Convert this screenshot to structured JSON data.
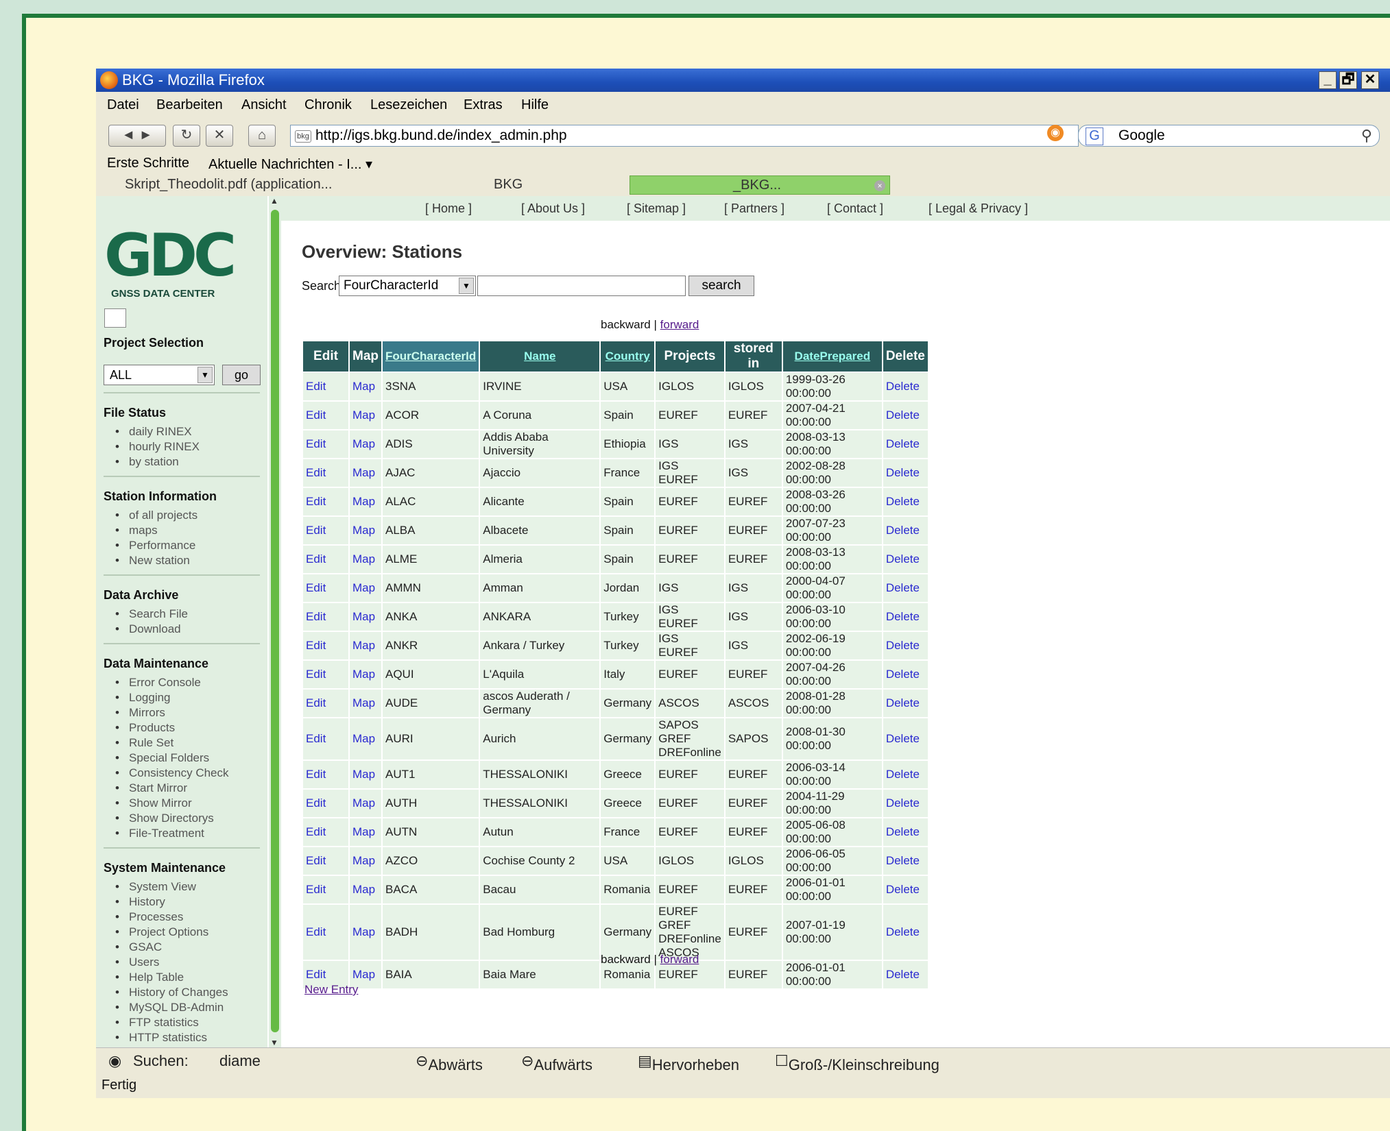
{
  "window": {
    "title": "BKG - Mozilla Firefox",
    "min": "_",
    "max": "🗗",
    "close": "✕"
  },
  "menu": [
    "Datei",
    "Bearbeiten",
    "Ansicht",
    "Chronik",
    "Lesezeichen",
    "Extras",
    "Hilfe"
  ],
  "nav": {
    "url": "http://igs.bkg.bund.de/index_admin.php",
    "search_engine": "Google"
  },
  "bookmarks": [
    "Erste Schritte",
    "Aktuelle Nachrichten - I... ▾"
  ],
  "tabs": [
    {
      "label": "Skript_Theodolit.pdf (application..."
    },
    {
      "label": "BKG"
    },
    {
      "label": "_BKG..."
    }
  ],
  "topnav": [
    "[ Home ]",
    "[ About Us ]",
    "[ Sitemap ]",
    "[ Partners ]",
    "[ Contact ]",
    "[ Legal & Privacy ]"
  ],
  "sidebar": {
    "logo_big": "GDC",
    "logo_small": "GNSS DATA CENTER",
    "project_selection": "Project Selection",
    "project_value": "ALL",
    "go_label": "go",
    "file_status": {
      "title": "File Status",
      "items": [
        "daily RINEX",
        "hourly RINEX",
        "by station"
      ]
    },
    "station_info": {
      "title": "Station Information",
      "items": [
        "of all projects",
        "maps",
        "Performance",
        "New station"
      ]
    },
    "data_archive": {
      "title": "Data Archive",
      "items": [
        "Search File",
        "Download"
      ]
    },
    "data_maintenance": {
      "title": "Data Maintenance",
      "items": [
        "Error Console",
        "Logging",
        "Mirrors",
        "Products",
        "Rule Set",
        "Special Folders",
        "Consistency Check",
        "Start Mirror",
        "Show Mirror",
        "Show Directorys",
        "File-Treatment"
      ]
    },
    "system_maintenance": {
      "title": "System Maintenance",
      "items": [
        "System View",
        "History",
        "Processes",
        "Project Options",
        "GSAC",
        "Users",
        "Help Table",
        "History of Changes",
        "MySQL DB-Admin",
        "FTP statistics",
        "HTTP statistics"
      ]
    }
  },
  "main": {
    "title": "Overview: Stations",
    "search_label": "Search:",
    "search_field": "FourCharacterId",
    "search_button": "search",
    "pager_backward": "backward",
    "pager_sep": " | ",
    "pager_forward": "forward",
    "headers": [
      "Edit",
      "Map",
      "FourCharacterId",
      "Name",
      "Country",
      "Projects",
      "stored in",
      "DatePrepared",
      "Delete"
    ],
    "edit_label": "Edit",
    "map_label": "Map",
    "delete_label": "Delete",
    "rows": [
      [
        "3SNA",
        "IRVINE",
        "USA",
        "IGLOS",
        "IGLOS",
        "1999-03-26 00:00:00"
      ],
      [
        "ACOR",
        "A Coruna",
        "Spain",
        "EUREF",
        "EUREF",
        "2007-04-21 00:00:00"
      ],
      [
        "ADIS",
        "Addis Ababa University",
        "Ethiopia",
        "IGS",
        "IGS",
        "2008-03-13 00:00:00"
      ],
      [
        "AJAC",
        "Ajaccio",
        "France",
        "IGS\nEUREF",
        "IGS",
        "2002-08-28 00:00:00"
      ],
      [
        "ALAC",
        "Alicante",
        "Spain",
        "EUREF",
        "EUREF",
        "2008-03-26 00:00:00"
      ],
      [
        "ALBA",
        "Albacete",
        "Spain",
        "EUREF",
        "EUREF",
        "2007-07-23 00:00:00"
      ],
      [
        "ALME",
        "Almeria",
        "Spain",
        "EUREF",
        "EUREF",
        "2008-03-13 00:00:00"
      ],
      [
        "AMMN",
        "Amman",
        "Jordan",
        "IGS",
        "IGS",
        "2000-04-07 00:00:00"
      ],
      [
        "ANKA",
        "ANKARA",
        "Turkey",
        "IGS\nEUREF",
        "IGS",
        "2006-03-10 00:00:00"
      ],
      [
        "ANKR",
        "Ankara / Turkey",
        "Turkey",
        "IGS\nEUREF",
        "IGS",
        "2002-06-19 00:00:00"
      ],
      [
        "AQUI",
        "L'Aquila",
        "Italy",
        "EUREF",
        "EUREF",
        "2007-04-26 00:00:00"
      ],
      [
        "AUDE",
        "ascos Auderath / Germany",
        "Germany",
        "ASCOS",
        "ASCOS",
        "2008-01-28 00:00:00"
      ],
      [
        "AURI",
        "Aurich",
        "Germany",
        "SAPOS\nGREF\nDREFonline",
        "SAPOS",
        "2008-01-30 00:00:00"
      ],
      [
        "AUT1",
        "THESSALONIKI",
        "Greece",
        "EUREF",
        "EUREF",
        "2006-03-14 00:00:00"
      ],
      [
        "AUTH",
        "THESSALONIKI",
        "Greece",
        "EUREF",
        "EUREF",
        "2004-11-29 00:00:00"
      ],
      [
        "AUTN",
        "Autun",
        "France",
        "EUREF",
        "EUREF",
        "2005-06-08 00:00:00"
      ],
      [
        "AZCO",
        "Cochise County 2",
        "USA",
        "IGLOS",
        "IGLOS",
        "2006-06-05 00:00:00"
      ],
      [
        "BACA",
        "Bacau",
        "Romania",
        "EUREF",
        "EUREF",
        "2006-01-01 00:00:00"
      ],
      [
        "BADH",
        "Bad Homburg",
        "Germany",
        "EUREF\nGREF\nDREFonline\nASCOS",
        "EUREF",
        "2007-01-19 00:00:00"
      ],
      [
        "BAIA",
        "Baia Mare",
        "Romania",
        "EUREF",
        "EUREF",
        "2006-01-01 00:00:00"
      ]
    ],
    "new_entry": "New Entry"
  },
  "findbar": {
    "label": "Suchen:",
    "value": "diame",
    "down": "Abwärts",
    "up": "Aufwärts",
    "highlight": "Hervorheben",
    "case": "Groß-/Kleinschreibung"
  },
  "status": "Fertig"
}
